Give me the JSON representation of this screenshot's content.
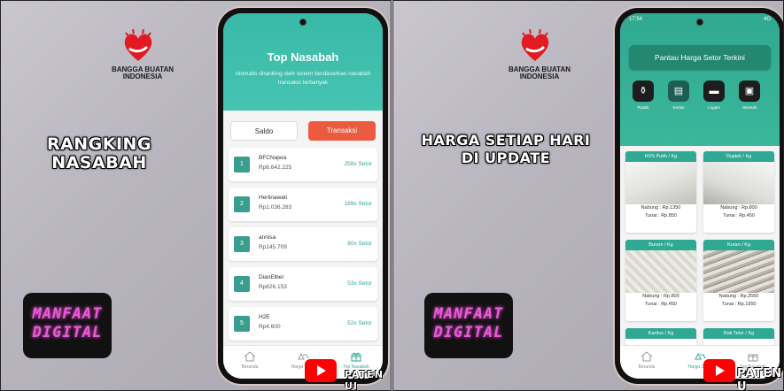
{
  "left_panel": {
    "logo_text": "BANGGA BUATAN INDONESIA",
    "headline_line1": "RANGKING",
    "headline_line2": "NASABAH",
    "badge_line1": "MANFAAT",
    "badge_line2": "DIGITAL",
    "phone": {
      "title": "Top Nasabah",
      "subtitle": "otomatis diranking oleh sistem berdasarkan nasabah transaksi terbanyak",
      "tabs": [
        {
          "label": "Saldo",
          "active": false
        },
        {
          "label": "Transaksi",
          "active": true
        }
      ],
      "ranking": [
        {
          "rank": "1",
          "name": "BFCNajwa",
          "amount": "Rp6.642.225",
          "setor": "258x Setor"
        },
        {
          "rank": "2",
          "name": "Herlinawati",
          "amount": "Rp1.036.283",
          "setor": "189x Setor"
        },
        {
          "rank": "3",
          "name": "annisa",
          "amount": "Rp145.709",
          "setor": "80x Setor"
        },
        {
          "rank": "4",
          "name": "DianElber",
          "amount": "Rp626.153",
          "setor": "53x Setor"
        },
        {
          "rank": "5",
          "name": "H2E",
          "amount": "Rp4.600",
          "setor": "52x Setor"
        }
      ],
      "nav": [
        {
          "label": "Beranda",
          "icon": "home-icon"
        },
        {
          "label": "Harga Setor",
          "icon": "recycle-icon"
        },
        {
          "label": "Top Nasabah",
          "icon": "gift-icon"
        }
      ]
    },
    "watermark": "PATEN UI"
  },
  "right_panel": {
    "logo_text": "BANGGA BUATAN INDONESIA",
    "headline_line1": "HARGA SETIAP HARI",
    "headline_line2": "DI UPDATE",
    "badge_line1": "MANFAAT",
    "badge_line2": "DIGITAL",
    "phone": {
      "status_time": "17:54",
      "status_right": "4G",
      "banner": "Pantau Harga Setor Terkini",
      "categories": [
        {
          "label": "Plastik",
          "icon": "bottle-icon"
        },
        {
          "label": "Kertas",
          "icon": "book-icon"
        },
        {
          "label": "Logam",
          "icon": "anvil-icon"
        },
        {
          "label": "Jelantah",
          "icon": "oil-jar-icon"
        }
      ],
      "prices": [
        {
          "title": "HVS Putih / Kg",
          "nabung": "Nabung : Rp.1350",
          "tunai": "Tunai : Rp.850"
        },
        {
          "title": "Duplek / Kg",
          "nabung": "Nabung : Rp.800",
          "tunai": "Tunai : Rp.450"
        },
        {
          "title": "Buram / Kg",
          "nabung": "Nabung : Rp.800",
          "tunai": "Tunai : Rp.450"
        },
        {
          "title": "Koran / Kg",
          "nabung": "Nabung : Rp.2550",
          "tunai": "Tunai : Rp.1950"
        },
        {
          "title": "Kardus / Kg",
          "nabung": "",
          "tunai": ""
        },
        {
          "title": "Rak Telur / Kg",
          "nabung": "",
          "tunai": ""
        }
      ],
      "nav": [
        {
          "label": "Beranda",
          "icon": "home-icon"
        },
        {
          "label": "Harga Setor",
          "icon": "recycle-icon"
        },
        {
          "label": "Top Nasabah",
          "icon": "gift-icon"
        }
      ]
    },
    "watermark": "PATEN U"
  },
  "colors": {
    "teal": "#39b9a7",
    "teal_dark": "#2fa894",
    "orange": "#ec5a3f",
    "youtube_red": "#ff0000",
    "badge_pink": "#e85bd8"
  }
}
